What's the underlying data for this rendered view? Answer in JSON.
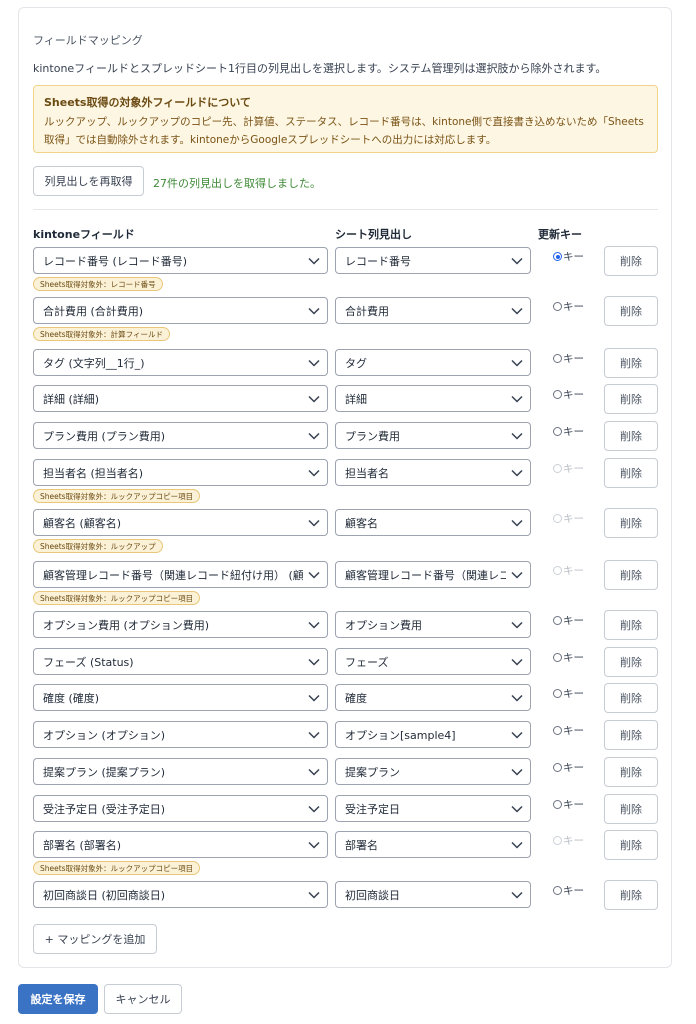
{
  "section_title": "フィールドマッピング",
  "description": "kintoneフィールドとスプレッドシート1行目の列見出しを選択します。システム管理列は選択肢から除外されます。",
  "notice": {
    "title": "Sheets取得の対象外フィールドについて",
    "body_line1": "ルックアップ、ルックアップのコピー先、計算値、ステータス、レコード番号は、kintone側で直接書き込めないため「Sheets",
    "body_line2": "取得」では自動除外されます。kintoneからGoogleスプレッドシートへの出力には対応します。"
  },
  "refetch_button": "列見出しを再取得",
  "fetch_status": "27件の列見出しを取得しました。",
  "columns": {
    "kintone": "kintoneフィールド",
    "sheet": "シート列見出し",
    "key": "更新キー"
  },
  "key_label": "キー",
  "delete_label": "削除",
  "rows": [
    {
      "kintone": "レコード番号 (レコード番号)",
      "sheet": "レコード番号",
      "badge": "Sheets取得対象外：レコード番号",
      "key_state": "selected"
    },
    {
      "kintone": "合計費用 (合計費用)",
      "sheet": "合計費用",
      "badge": "Sheets取得対象外：計算フィールド",
      "key_state": "enabled"
    },
    {
      "kintone": "タグ (文字列__1行_)",
      "sheet": "タグ",
      "badge": "",
      "key_state": "enabled"
    },
    {
      "kintone": "詳細 (詳細)",
      "sheet": "詳細",
      "badge": "",
      "key_state": "enabled"
    },
    {
      "kintone": "プラン費用 (プラン費用)",
      "sheet": "プラン費用",
      "badge": "",
      "key_state": "enabled"
    },
    {
      "kintone": "担当者名 (担当者名)",
      "sheet": "担当者名",
      "badge": "Sheets取得対象外：ルックアップコピー項目",
      "key_state": "disabled"
    },
    {
      "kintone": "顧客名 (顧客名)",
      "sheet": "顧客名",
      "badge": "Sheets取得対象外：ルックアップ",
      "key_state": "disabled"
    },
    {
      "kintone": "顧客管理レコード番号（関連レコード紐付け用） (顧客",
      "sheet": "顧客管理レコード番号（関連レコ",
      "badge": "Sheets取得対象外：ルックアップコピー項目",
      "key_state": "disabled"
    },
    {
      "kintone": "オプション費用 (オプション費用)",
      "sheet": "オプション費用",
      "badge": "",
      "key_state": "enabled"
    },
    {
      "kintone": "フェーズ (Status)",
      "sheet": "フェーズ",
      "badge": "",
      "key_state": "enabled"
    },
    {
      "kintone": "確度 (確度)",
      "sheet": "確度",
      "badge": "",
      "key_state": "enabled"
    },
    {
      "kintone": "オプション (オプション)",
      "sheet": "オプション[sample4]",
      "badge": "",
      "key_state": "enabled"
    },
    {
      "kintone": "提案プラン (提案プラン)",
      "sheet": "提案プラン",
      "badge": "",
      "key_state": "enabled"
    },
    {
      "kintone": "受注予定日 (受注予定日)",
      "sheet": "受注予定日",
      "badge": "",
      "key_state": "enabled"
    },
    {
      "kintone": "部署名 (部署名)",
      "sheet": "部署名",
      "badge": "Sheets取得対象外：ルックアップコピー項目",
      "key_state": "disabled"
    },
    {
      "kintone": "初回商談日 (初回商談日)",
      "sheet": "初回商談日",
      "badge": "",
      "key_state": "enabled"
    }
  ],
  "add_mapping_button": "+ マッピングを追加",
  "save_button": "設定を保存",
  "cancel_button": "キャンセル",
  "colors": {
    "primary": "#3b73c4",
    "notice_bg": "#fdf6e3",
    "notice_border": "#f0d48a",
    "success_text": "#3f8a37",
    "badge_bg": "#fbf1d6"
  },
  "icons": {
    "select_arrow": "chevron-down-icon",
    "radio": "radio-icon"
  }
}
